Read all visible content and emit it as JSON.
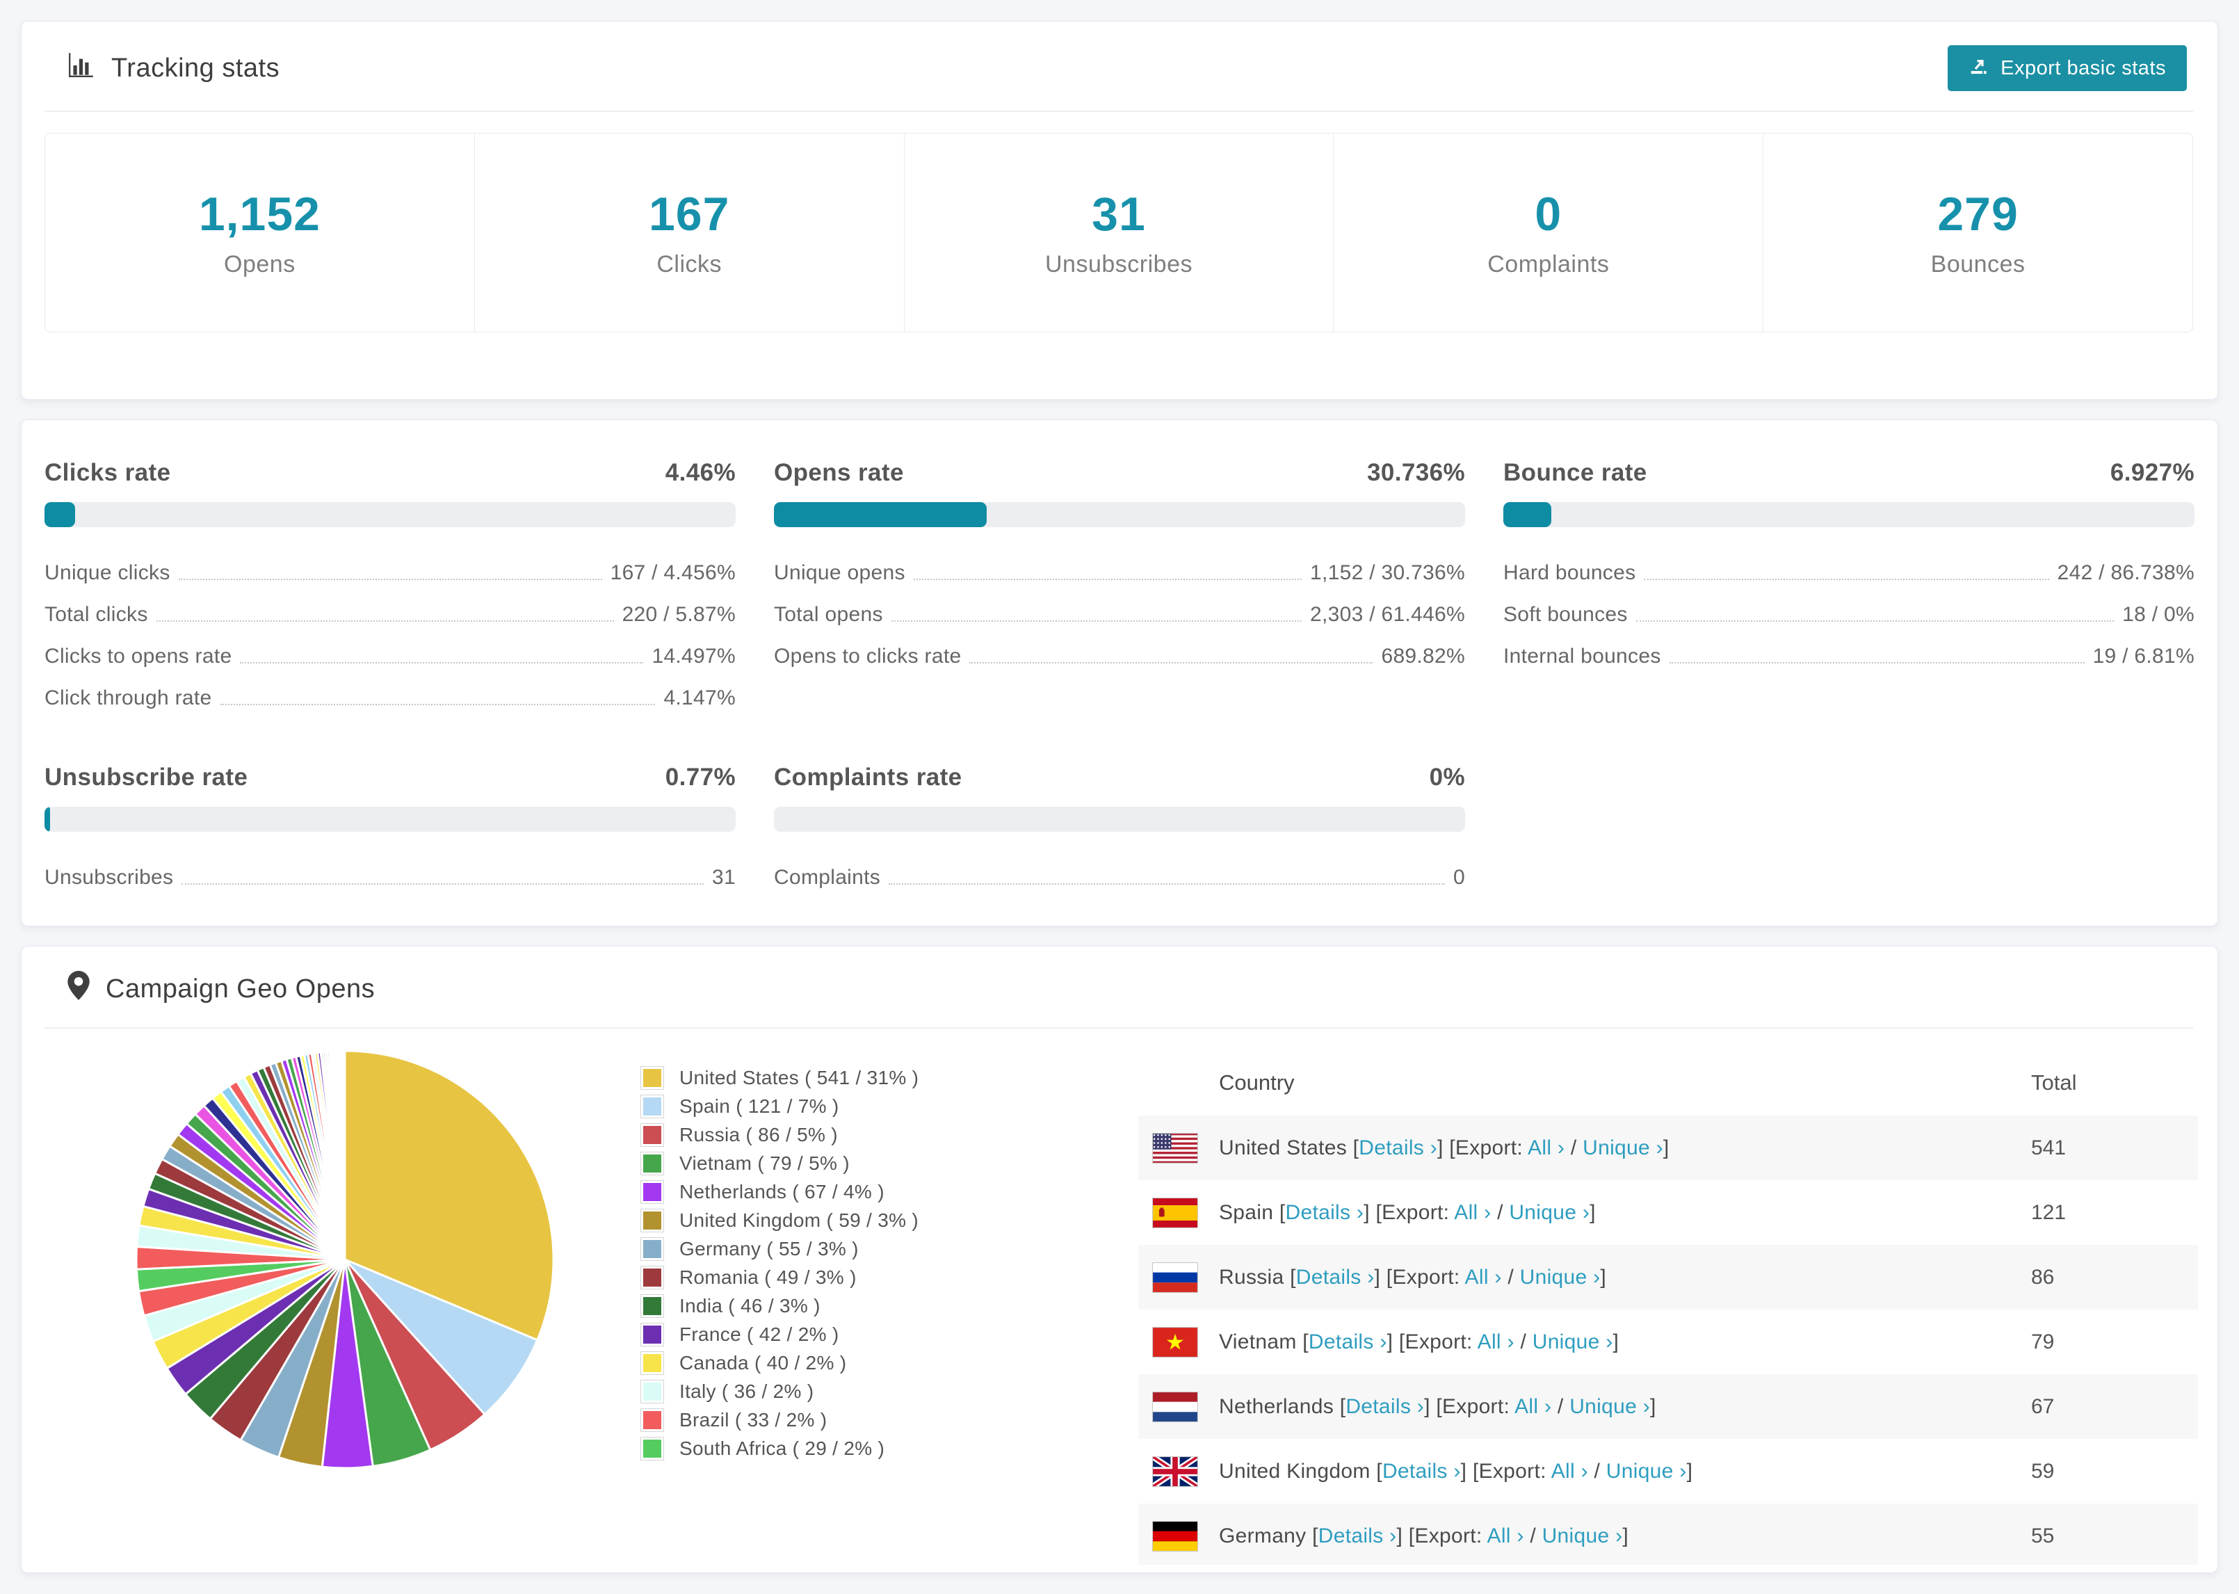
{
  "accent_color": "#1b8fa3",
  "link_color": "#2e9dbf",
  "tracking": {
    "title": "Tracking stats",
    "export_label": "Export basic stats",
    "summary": [
      {
        "key": "opens",
        "value": "1,152",
        "label": "Opens"
      },
      {
        "key": "clicks",
        "value": "167",
        "label": "Clicks"
      },
      {
        "key": "unsubscribes",
        "value": "31",
        "label": "Unsubscribes"
      },
      {
        "key": "complaints",
        "value": "0",
        "label": "Complaints"
      },
      {
        "key": "bounces",
        "value": "279",
        "label": "Bounces"
      }
    ]
  },
  "rates": [
    {
      "key": "clicks",
      "title": "Clicks rate",
      "value": "4.46%",
      "percent": 4.46,
      "rows": [
        {
          "label": "Unique clicks",
          "value": "167 / 4.456%"
        },
        {
          "label": "Total clicks",
          "value": "220 / 5.87%"
        },
        {
          "label": "Clicks to opens rate",
          "value": "14.497%"
        },
        {
          "label": "Click through rate",
          "value": "4.147%"
        }
      ]
    },
    {
      "key": "opens",
      "title": "Opens rate",
      "value": "30.736%",
      "percent": 30.736,
      "rows": [
        {
          "label": "Unique opens",
          "value": "1,152 / 30.736%"
        },
        {
          "label": "Total opens",
          "value": "2,303 / 61.446%"
        },
        {
          "label": "Opens to clicks rate",
          "value": "689.82%"
        }
      ]
    },
    {
      "key": "bounce",
      "title": "Bounce rate",
      "value": "6.927%",
      "percent": 6.927,
      "rows": [
        {
          "label": "Hard bounces",
          "value": "242 / 86.738%"
        },
        {
          "label": "Soft bounces",
          "value": "18 / 0%"
        },
        {
          "label": "Internal bounces",
          "value": "19 / 6.81%"
        }
      ]
    },
    {
      "key": "unsubscribe",
      "title": "Unsubscribe rate",
      "value": "0.77%",
      "percent": 0.77,
      "rows": [
        {
          "label": "Unsubscribes",
          "value": "31"
        }
      ]
    },
    {
      "key": "complaints",
      "title": "Complaints rate",
      "value": "0%",
      "percent": 0,
      "rows": [
        {
          "label": "Complaints",
          "value": "0"
        }
      ]
    }
  ],
  "geo": {
    "title": "Campaign Geo Opens",
    "chart_data": {
      "type": "pie",
      "title": "Campaign Geo Opens",
      "legend_position": "right",
      "start_angle_deg": -90,
      "direction": "clockwise",
      "labels": [
        "United States",
        "Spain",
        "Russia",
        "Vietnam",
        "Netherlands",
        "United Kingdom",
        "Germany",
        "Romania",
        "India",
        "France",
        "Canada",
        "Italy",
        "Brazil",
        "South Africa"
      ],
      "values": [
        541,
        121,
        86,
        79,
        67,
        59,
        55,
        49,
        46,
        42,
        40,
        36,
        33,
        29
      ],
      "colors": [
        "#e7c442",
        "#b5d9f4",
        "#cc4d52",
        "#46a64c",
        "#a238f0",
        "#b2922f",
        "#87aec9",
        "#9d3a3d",
        "#337a39",
        "#6c2fb2",
        "#f6e44a",
        "#d9fcf7",
        "#f25c5c",
        "#55cc60"
      ],
      "legend_labels": [
        "United States ( 541 / 31% )",
        "Spain ( 121 / 7% )",
        "Russia ( 86 / 5% )",
        "Vietnam ( 79 / 5% )",
        "Netherlands ( 67 / 4% )",
        "United Kingdom ( 59 / 3% )",
        "Germany ( 55 / 3% )",
        "Romania ( 49 / 3% )",
        "India ( 46 / 3% )",
        "France ( 42 / 2% )",
        "Canada ( 40 / 2% )",
        "Italy ( 36 / 2% )",
        "Brazil ( 33 / 2% )",
        "South Africa ( 29 / 2% )"
      ],
      "others": {
        "note": "unlabeled tail of small-country slices",
        "values": [
          30,
          28,
          26,
          24,
          22,
          21,
          20,
          19,
          18,
          17,
          16,
          15,
          14,
          13,
          12,
          11,
          10,
          10,
          9,
          9,
          8,
          8,
          7,
          7,
          6,
          6,
          5,
          5,
          5,
          4,
          4,
          4,
          3,
          3,
          3,
          3,
          2,
          2,
          2,
          2,
          2,
          2,
          1,
          1,
          1,
          1,
          1,
          1,
          1,
          1
        ],
        "palette": [
          "#f25c5c",
          "#d9fcf7",
          "#f6e44a",
          "#6c2fb2",
          "#337a39",
          "#9d3a3d",
          "#87aec9",
          "#b2922f",
          "#a238f0",
          "#46a64c",
          "#e955e2",
          "#2e3192",
          "#ffff54",
          "#8ed0f0"
        ]
      }
    },
    "table": {
      "headers": [
        "Country",
        "Total"
      ],
      "links": {
        "details": "Details ›",
        "export_prefix": "Export:",
        "all": "All ›",
        "unique": "Unique ›"
      },
      "rows": [
        {
          "country": "United States",
          "flag": "us",
          "total": "541"
        },
        {
          "country": "Spain",
          "flag": "es",
          "total": "121"
        },
        {
          "country": "Russia",
          "flag": "ru",
          "total": "86"
        },
        {
          "country": "Vietnam",
          "flag": "vn",
          "total": "79"
        },
        {
          "country": "Netherlands",
          "flag": "nl",
          "total": "67"
        },
        {
          "country": "United Kingdom",
          "flag": "gb",
          "total": "59"
        },
        {
          "country": "Germany",
          "flag": "de",
          "total": "55"
        }
      ]
    }
  }
}
